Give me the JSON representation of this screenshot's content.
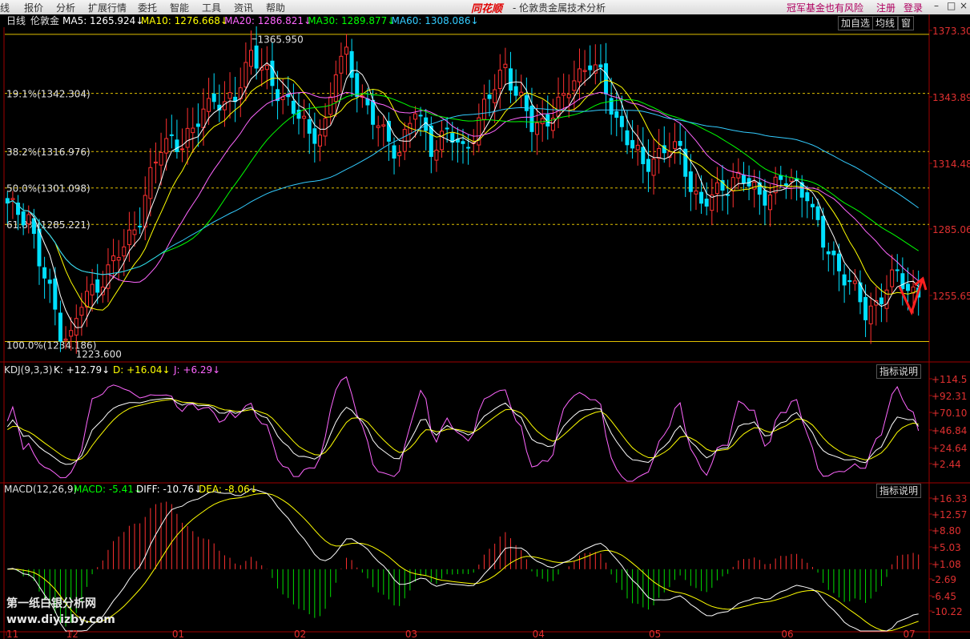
{
  "menubar": {
    "items": [
      "线",
      "报价",
      "分析",
      "扩展行情",
      "委托",
      "智能",
      "工具",
      "资讯",
      "帮助"
    ],
    "brand": "同花顺",
    "title": "- 伦敦贵金属技术分析",
    "links": [
      "冠军基金也有风险",
      "注册",
      "登录"
    ]
  },
  "main": {
    "period": "日线",
    "symbol": "伦敦金",
    "ma": [
      {
        "label": "MA5: 1265.924",
        "color": "#ffffff"
      },
      {
        "label": "MA10: 1276.668",
        "color": "#ffff00"
      },
      {
        "label": "MA20: 1286.821",
        "color": "#ff66ff"
      },
      {
        "label": "MA30: 1289.877",
        "color": "#00ff00"
      },
      {
        "label": "MA60: 1308.086",
        "color": "#33ccff"
      }
    ],
    "buttons": [
      "加自选",
      "均线",
      "窗"
    ],
    "price_axis": [
      "1373.303",
      "1343.892",
      "1314.481",
      "1285.069",
      "1255.658"
    ],
    "fib": [
      {
        "label": "19.1%(1342.304)",
        "price": 1342.304
      },
      {
        "label": "38.2%(1316.976)",
        "price": 1316.976
      },
      {
        "label": "50.0%(1301.098)",
        "price": 1301.098
      },
      {
        "label": "61.8%(1285.221)",
        "price": 1285.221
      },
      {
        "label": "100.0%(1234.186)",
        "price": 1234.186
      }
    ],
    "top_line_price": 1368.0,
    "high_label": "1365.950",
    "low_label": "1223.600",
    "range": [
      1226,
      1376
    ]
  },
  "kdj": {
    "title": "KDJ(9,3,3)",
    "k_label": "K: +12.79",
    "d_label": "D: +16.04",
    "j_label": "J: +6.29",
    "colors": {
      "k": "#ffffff",
      "d": "#ffff00",
      "j": "#ff66ff"
    },
    "axis": [
      "+114.5",
      "+92.31",
      "+70.10",
      "+46.84",
      "+24.64",
      "+2.44"
    ],
    "button": "指标说明",
    "range": [
      -5,
      125
    ]
  },
  "macd": {
    "title": "MACD(12,26,9)",
    "macd_label": "MACD: -5.41",
    "diff_label": "DIFF: -10.76",
    "dea_label": "DEA: -8.06",
    "colors": {
      "macd": "#00ff00",
      "diff": "#ffffff",
      "dea": "#ffff00",
      "up": "#ff3030",
      "down": "#00dd00"
    },
    "axis": [
      "+16.33",
      "+12.57",
      "+8.80",
      "+5.03",
      "+1.08",
      "-2.69",
      "-6.45",
      "-10.22"
    ],
    "button": "指标说明",
    "range": [
      -13,
      18
    ]
  },
  "time_axis": [
    {
      "label": "11",
      "idx": 0
    },
    {
      "label": "12",
      "idx": 12
    },
    {
      "label": "01",
      "idx": 32
    },
    {
      "label": "02",
      "idx": 55
    },
    {
      "label": "03",
      "idx": 76
    },
    {
      "label": "04",
      "idx": 100
    },
    {
      "label": "05",
      "idx": 122
    },
    {
      "label": "06",
      "idx": 147
    },
    {
      "label": "07",
      "idx": 170
    }
  ],
  "watermark": [
    "第一纸白银分析网",
    "www.diyizby.com"
  ],
  "chart_data": {
    "type": "candlestick",
    "anchors_close": [
      [
        0,
        1292
      ],
      [
        4,
        1290
      ],
      [
        6,
        1268
      ],
      [
        8,
        1255
      ],
      [
        10,
        1240
      ],
      [
        12,
        1236
      ],
      [
        14,
        1250
      ],
      [
        17,
        1260
      ],
      [
        20,
        1268
      ],
      [
        22,
        1275
      ],
      [
        25,
        1290
      ],
      [
        27,
        1305
      ],
      [
        29,
        1318
      ],
      [
        31,
        1324
      ],
      [
        33,
        1320
      ],
      [
        35,
        1324
      ],
      [
        37,
        1336
      ],
      [
        39,
        1342
      ],
      [
        41,
        1335
      ],
      [
        43,
        1340
      ],
      [
        45,
        1355
      ],
      [
        46,
        1362
      ],
      [
        48,
        1352
      ],
      [
        50,
        1345
      ],
      [
        53,
        1340
      ],
      [
        55,
        1332
      ],
      [
        57,
        1322
      ],
      [
        60,
        1330
      ],
      [
        62,
        1352
      ],
      [
        64,
        1358
      ],
      [
        66,
        1346
      ],
      [
        69,
        1330
      ],
      [
        71,
        1324
      ],
      [
        74,
        1318
      ],
      [
        77,
        1334
      ],
      [
        80,
        1320
      ],
      [
        83,
        1324
      ],
      [
        86,
        1318
      ],
      [
        89,
        1330
      ],
      [
        92,
        1345
      ],
      [
        94,
        1356
      ],
      [
        96,
        1342
      ],
      [
        99,
        1328
      ],
      [
        102,
        1332
      ],
      [
        105,
        1338
      ],
      [
        107,
        1350
      ],
      [
        110,
        1356
      ],
      [
        112,
        1348
      ],
      [
        115,
        1332
      ],
      [
        118,
        1318
      ],
      [
        120,
        1310
      ],
      [
        122,
        1316
      ],
      [
        125,
        1318
      ],
      [
        127,
        1316
      ],
      [
        129,
        1304
      ],
      [
        131,
        1293
      ],
      [
        133,
        1296
      ],
      [
        135,
        1302
      ],
      [
        137,
        1306
      ],
      [
        140,
        1302
      ],
      [
        142,
        1298
      ],
      [
        145,
        1302
      ],
      [
        148,
        1304
      ],
      [
        151,
        1300
      ],
      [
        152,
        1290
      ],
      [
        154,
        1276
      ],
      [
        156,
        1270
      ],
      [
        158,
        1264
      ],
      [
        160,
        1255
      ],
      [
        162,
        1246
      ],
      [
        164,
        1252
      ],
      [
        166,
        1258
      ],
      [
        168,
        1262
      ],
      [
        170,
        1258
      ],
      [
        172,
        1256
      ]
    ],
    "n": 173
  }
}
